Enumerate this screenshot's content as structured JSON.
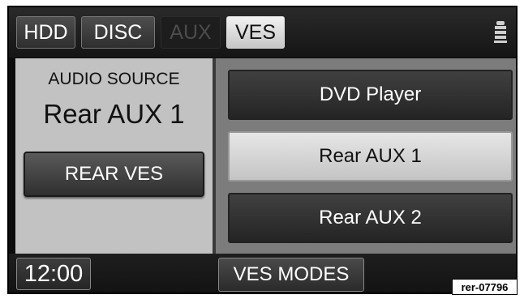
{
  "tabs": [
    {
      "label": "HDD",
      "state": "normal"
    },
    {
      "label": "DISC",
      "state": "normal"
    },
    {
      "label": "AUX",
      "state": "disabled"
    },
    {
      "label": "VES",
      "state": "active"
    }
  ],
  "header": {
    "rear_seat_icon": "rear-seat-icon"
  },
  "source_panel": {
    "label": "AUDIO SOURCE",
    "value": "Rear AUX 1",
    "rear_ves_button": "REAR VES"
  },
  "source_options": [
    {
      "label": "DVD Player",
      "selected": false
    },
    {
      "label": "Rear AUX 1",
      "selected": true
    },
    {
      "label": "Rear AUX 2",
      "selected": false
    }
  ],
  "bottom": {
    "clock": "12:00",
    "ves_modes_button": "VES MODES"
  },
  "figure_code": "rer-07796",
  "colors": {
    "panel_light": "#c2c2c2",
    "panel_dark": "#7c7c7c",
    "button_dark": "#2f2f2f",
    "button_selected": "#d4d4d4"
  }
}
